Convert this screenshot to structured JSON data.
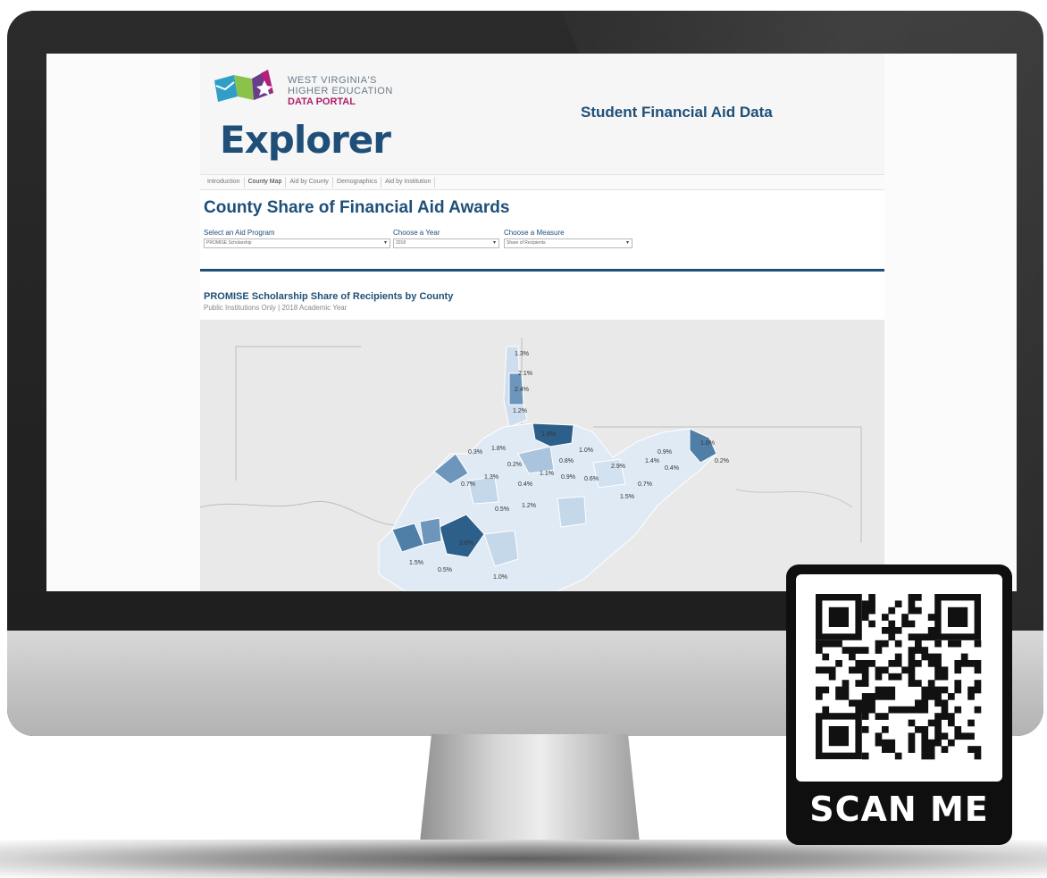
{
  "logo": {
    "line1": "WEST VIRGINIA'S",
    "line2": "HIGHER EDUCATION",
    "line3": "DATA PORTAL",
    "wordmark": "Explorer"
  },
  "header": {
    "title": "Student Financial Aid Data"
  },
  "tabs": [
    {
      "label": "Introduction",
      "active": false
    },
    {
      "label": "County Map",
      "active": true
    },
    {
      "label": "Aid by County",
      "active": false
    },
    {
      "label": "Demographics",
      "active": false
    },
    {
      "label": "Aid by Institution",
      "active": false
    }
  ],
  "page": {
    "title": "County Share of Financial Aid Awards"
  },
  "filters": [
    {
      "label": "Select an Aid Program",
      "value": "PROMISE Scholarship"
    },
    {
      "label": "Choose a Year",
      "value": "2018"
    },
    {
      "label": "Choose a Measure",
      "value": "Share of Recipients"
    }
  ],
  "map": {
    "title": "PROMISE Scholarship Share of Recipients by County",
    "subtitle": "Public Institutions Only | 2018 Academic Year",
    "labels": [
      "1.3%",
      "2.1%",
      "2.4%",
      "1.2%",
      "0.3%",
      "1.8%",
      "0.2%",
      "1.3%",
      "0.7%",
      "0.4%",
      "1.1%",
      "0.8%",
      "1.9%",
      "1.0%",
      "0.9%",
      "2.9%",
      "0.6%",
      "1.5%",
      "1.4%",
      "0.7%",
      "0.9%",
      "0.4%",
      "1.0%",
      "0.2%",
      "0.5%",
      "1.2%",
      "3.8%",
      "1.5%",
      "0.5%",
      "1.0%"
    ],
    "colors": {
      "light": "#e3edf6",
      "mid": "#a9c4dc",
      "dark": "#4f7ea7",
      "darkest": "#2c5f8a"
    }
  },
  "qr": {
    "label": "SCAN ME"
  }
}
